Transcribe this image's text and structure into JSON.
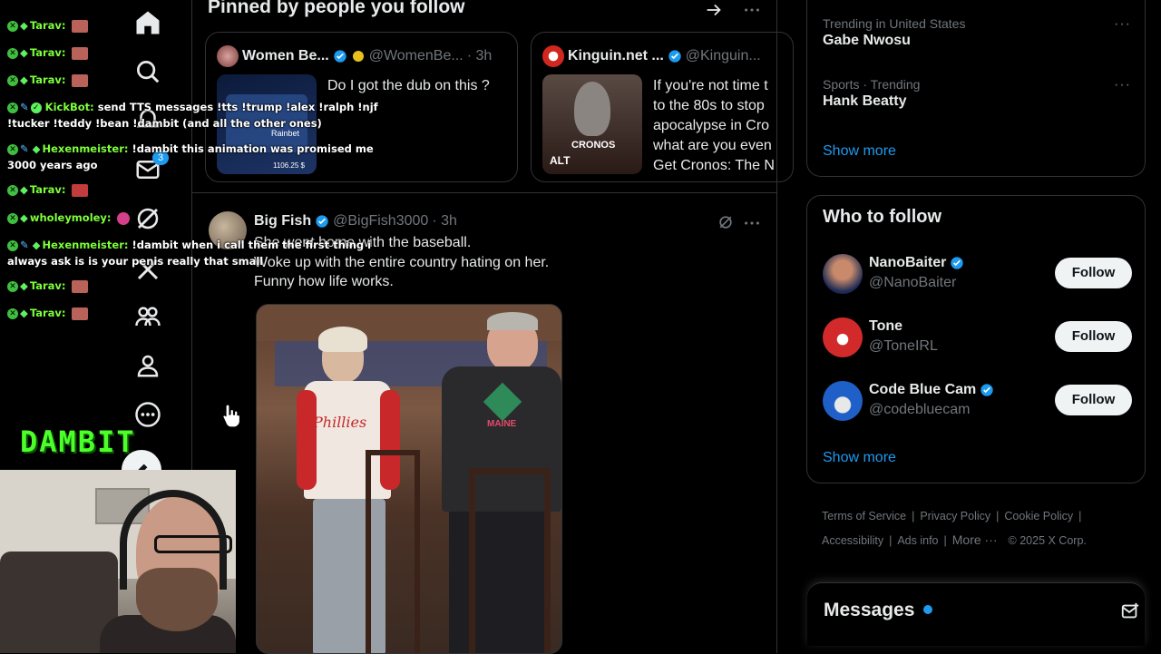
{
  "chat": {
    "lines": [
      {
        "name": "Tarav:",
        "msg": ""
      },
      {
        "name": "Tarav:",
        "msg": ""
      },
      {
        "name": "Tarav:",
        "msg": ""
      },
      {
        "name": "KickBot:",
        "msg": "send TTS messages !tts !trump !alex !ralph !njf !tucker !teddy !bean !dambit (and all the other ones)"
      },
      {
        "name": "Hexenmeister:",
        "msg": "!dambit this animation was promised me 3000 years ago"
      },
      {
        "name": "Tarav:",
        "msg": ""
      },
      {
        "name": "wholeymoley:",
        "msg": ""
      },
      {
        "name": "Hexenmeister:",
        "msg": "!dambit when i call them the first thing i always ask is is your penis really that small"
      },
      {
        "name": "Tarav:",
        "msg": ""
      },
      {
        "name": "Tarav:",
        "msg": ""
      }
    ]
  },
  "overlay": {
    "logo_text": "DAMBIT"
  },
  "nav": {
    "messages_badge": "3"
  },
  "main": {
    "pinned_title": "Pinned by people you follow",
    "cards": [
      {
        "name": "Women Be...",
        "handle": "@WomenBe...",
        "time": "· 3h",
        "text": "Do I got the dub on this ?",
        "thumb_label": "Rainbet",
        "thumb_amount": "1106.25 $"
      },
      {
        "name": "Kinguin.net ...",
        "handle": "@Kinguin...",
        "time": "",
        "text": "If you're not time t to the 80s to stop apocalypse in Cro what are you even Get Cronos: The N",
        "thumb_label": "CRONOS",
        "thumb_alt": "ALT"
      }
    ],
    "post": {
      "name": "Big Fish",
      "handle": "@BigFish3000",
      "time": "· 3h",
      "lines": [
        "She went home with the baseball.",
        "Woke up with the entire country hating on her.",
        "Funny how life works."
      ],
      "image_shirt_left": "Phillies",
      "image_shirt_right": "MAINE"
    }
  },
  "sidebar": {
    "trends": [
      {
        "context": "Trending in United States",
        "title": "Gabe Nwosu"
      },
      {
        "context": "Sports · Trending",
        "title": "Hank Beatty"
      }
    ],
    "trends_show_more": "Show more",
    "who_to_follow": {
      "title": "Who to follow",
      "accounts": [
        {
          "name": "NanoBaiter",
          "handle": "@NanoBaiter",
          "verified": true,
          "button": "Follow"
        },
        {
          "name": "Tone",
          "handle": "@ToneIRL",
          "verified": false,
          "button": "Follow"
        },
        {
          "name": "Code Blue Cam",
          "handle": "@codebluecam",
          "verified": true,
          "button": "Follow"
        }
      ],
      "show_more": "Show more"
    },
    "footer": {
      "terms": "Terms of Service",
      "privacy": "Privacy Policy",
      "cookie": "Cookie Policy",
      "accessibility": "Accessibility",
      "ads": "Ads info",
      "more": "More ···",
      "copyright": "© 2025 X Corp."
    },
    "messages": {
      "title": "Messages"
    }
  },
  "colors": {
    "accent": "#1d9bf0",
    "chat_name": "#7dff3a",
    "logo": "#4cff2a"
  }
}
